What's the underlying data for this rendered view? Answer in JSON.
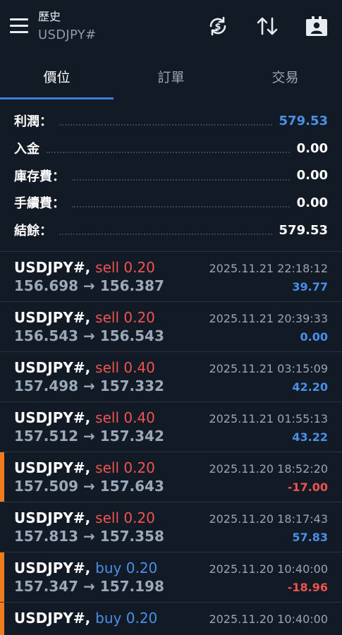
{
  "header": {
    "title": "歷史",
    "symbol": "USDJPY#"
  },
  "icons": {
    "menu": "hamburger-menu-icon",
    "sync": "sync-currency-icon",
    "sort": "sort-arrows-icon",
    "account": "account-badge-icon"
  },
  "tabs": [
    {
      "label": "價位",
      "active": true
    },
    {
      "label": "訂單",
      "active": false
    },
    {
      "label": "交易",
      "active": false
    }
  ],
  "summary": [
    {
      "label": "利潤：",
      "value": "579.53",
      "accent": true
    },
    {
      "label": "入金",
      "value": "0.00",
      "accent": false
    },
    {
      "label": "庫存費：",
      "value": "0.00",
      "accent": false
    },
    {
      "label": "手續費：",
      "value": "0.00",
      "accent": false
    },
    {
      "label": "結餘：",
      "value": "579.53",
      "accent": false
    }
  ],
  "trades": [
    {
      "symbol": "USDJPY#,",
      "side": "sell",
      "volume": "0.20",
      "open": "156.698",
      "close": "156.387",
      "time": "2025.11.21 22:18:12",
      "profit": "39.77",
      "flag": false
    },
    {
      "symbol": "USDJPY#,",
      "side": "sell",
      "volume": "0.20",
      "open": "156.543",
      "close": "156.543",
      "time": "2025.11.21 20:39:33",
      "profit": "0.00",
      "flag": false
    },
    {
      "symbol": "USDJPY#,",
      "side": "sell",
      "volume": "0.40",
      "open": "157.498",
      "close": "157.332",
      "time": "2025.11.21 03:15:09",
      "profit": "42.20",
      "flag": false
    },
    {
      "symbol": "USDJPY#,",
      "side": "sell",
      "volume": "0.40",
      "open": "157.512",
      "close": "157.342",
      "time": "2025.11.21 01:55:13",
      "profit": "43.22",
      "flag": false
    },
    {
      "symbol": "USDJPY#,",
      "side": "sell",
      "volume": "0.20",
      "open": "157.509",
      "close": "157.643",
      "time": "2025.11.20 18:52:20",
      "profit": "-17.00",
      "flag": true
    },
    {
      "symbol": "USDJPY#,",
      "side": "sell",
      "volume": "0.20",
      "open": "157.813",
      "close": "157.358",
      "time": "2025.11.20 18:17:43",
      "profit": "57.83",
      "flag": false
    },
    {
      "symbol": "USDJPY#,",
      "side": "buy",
      "volume": "0.20",
      "open": "157.347",
      "close": "157.198",
      "time": "2025.11.20 10:40:00",
      "profit": "-18.96",
      "flag": true
    },
    {
      "symbol": "USDJPY#,",
      "side": "buy",
      "volume": "0.20",
      "open": "",
      "close": "",
      "time": "2025.11.20 10:40:00",
      "profit": "",
      "flag": true
    }
  ],
  "colors": {
    "background": "#121a26",
    "accent_blue": "#4a8fe8",
    "sell_red": "#ef5350",
    "flag_orange": "#f07c1e"
  }
}
